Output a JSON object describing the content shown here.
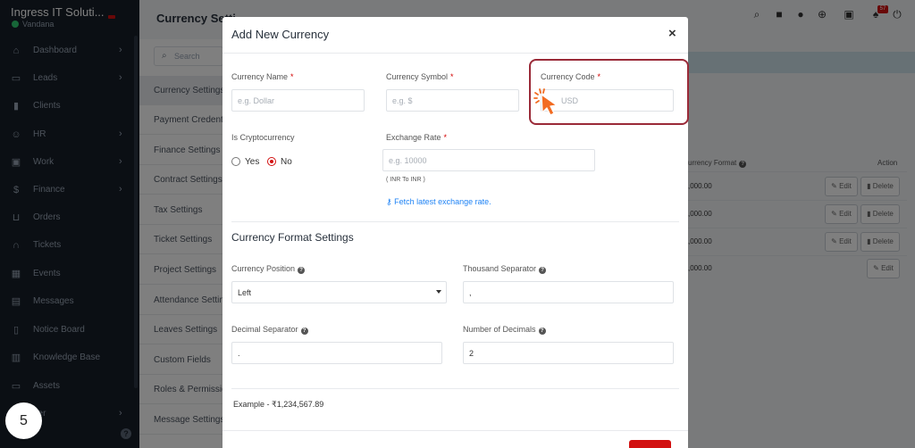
{
  "sidebar": {
    "brand_name": "Ingress IT Soluti...",
    "user_name": "Vandana",
    "items": [
      {
        "label": "Dashboard",
        "icon": "home-icon",
        "chevron": "›"
      },
      {
        "label": "Leads",
        "icon": "id-card-icon",
        "chevron": "›"
      },
      {
        "label": "Clients",
        "icon": "chart-icon",
        "chevron": ""
      },
      {
        "label": "HR",
        "icon": "people-icon",
        "chevron": "›"
      },
      {
        "label": "Work",
        "icon": "briefcase-icon",
        "chevron": "›"
      },
      {
        "label": "Finance",
        "icon": "dollar-icon",
        "chevron": "›"
      },
      {
        "label": "Orders",
        "icon": "cart-icon",
        "chevron": ""
      },
      {
        "label": "Tickets",
        "icon": "headset-icon",
        "chevron": ""
      },
      {
        "label": "Events",
        "icon": "calendar-icon",
        "chevron": ""
      },
      {
        "label": "Messages",
        "icon": "chat-icon",
        "chevron": ""
      },
      {
        "label": "Notice Board",
        "icon": "notice-icon",
        "chevron": ""
      },
      {
        "label": "Knowledge Base",
        "icon": "book-icon",
        "chevron": ""
      },
      {
        "label": "Assets",
        "icon": "monitor-icon",
        "chevron": ""
      },
      {
        "label": "tter",
        "icon": "letter-icon",
        "chevron": "›"
      }
    ]
  },
  "step_number": "5",
  "page": {
    "title": "Currency Setti",
    "search_placeholder": "Search",
    "notification_count": "57"
  },
  "settings_menu": [
    "Currency Settings",
    "Payment Credentials",
    "Finance Settings",
    "Contract Settings",
    "Tax Settings",
    "Ticket Settings",
    "Project Settings",
    "Attendance Settings",
    "Leaves Settings",
    "Custom Fields",
    "Roles & Permissions",
    "Message Settings"
  ],
  "table": {
    "format_header": "urrency Format",
    "action_header": "Action",
    "rows": [
      {
        "format": ",000.00",
        "actions": [
          "Edit",
          "Delete"
        ]
      },
      {
        "format": ",000.00",
        "actions": [
          "Edit",
          "Delete"
        ]
      },
      {
        "format": ",000.00",
        "actions": [
          "Edit",
          "Delete"
        ]
      },
      {
        "format": ",000.00",
        "actions": [
          "Edit"
        ]
      }
    ]
  },
  "modal": {
    "title": "Add New Currency",
    "close": "×",
    "currency_name": {
      "label": "Currency Name",
      "placeholder": "e.g. Dollar"
    },
    "currency_symbol": {
      "label": "Currency Symbol",
      "placeholder": "e.g. $"
    },
    "currency_code": {
      "label": "Currency Code",
      "placeholder": "USD"
    },
    "required_mark": "*",
    "is_crypto": {
      "label": "Is Cryptocurrency",
      "options": [
        "Yes",
        "No"
      ],
      "selected": "No"
    },
    "exchange_rate": {
      "label": "Exchange Rate",
      "placeholder": "e.g. 10000",
      "hint": "( INR To INR )",
      "fetch_link": "Fetch latest exchange rate."
    },
    "format_section_title": "Currency Format Settings",
    "currency_position": {
      "label": "Currency Position",
      "value": "Left"
    },
    "thousand_separator": {
      "label": "Thousand Separator",
      "value": ","
    },
    "decimal_separator": {
      "label": "Decimal Separator",
      "value": "."
    },
    "number_of_decimals": {
      "label": "Number of Decimals",
      "value": "2"
    },
    "example": "Example - ₹1,234,567.89"
  },
  "colors": {
    "sidebar_bg": "#171f29",
    "accent_red": "#d21010",
    "link_blue": "#1d82f5",
    "highlight_border": "#9a2a38",
    "cursor_orange": "#f26b21"
  }
}
